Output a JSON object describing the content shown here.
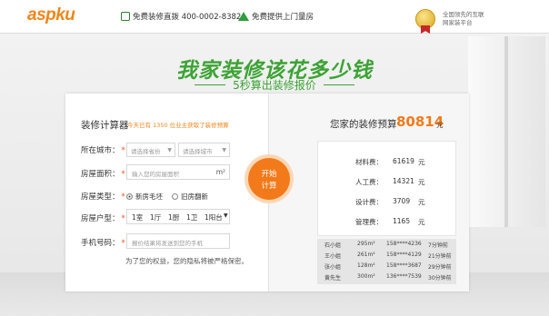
{
  "header": {
    "logo": "aspku",
    "hotline_text": "免费装修直拨 400-0002-8382",
    "house_text": "免费提供上门量房",
    "award_text": "全国领先的互联网家装平台"
  },
  "hero": {
    "title": "我家装修该花多少钱",
    "subtitle": "5秒算出装修报价"
  },
  "calculator": {
    "title": "装修计算器",
    "note": "今天已有 1350 位业主获取了装修预算",
    "city_label": "所在城市：",
    "province_placeholder": "请选择省份",
    "city_placeholder": "请选择城市",
    "area_label": "房屋面积：",
    "area_placeholder": "输入您的房屋面积",
    "area_unit": "m²",
    "type_label": "房屋类型：",
    "type_options": [
      "新房毛坯",
      "旧房翻新"
    ],
    "layout_label": "房屋户型：",
    "layout_options": [
      "1室",
      "1厅",
      "1厨",
      "1卫",
      "1阳台"
    ],
    "phone_label": "手机号码：",
    "phone_placeholder": "报价结果将发送到您的手机",
    "privacy_note": "为了您的权益，您的隐私将被严格保密。",
    "required_mark": "*",
    "start_button": [
      "开始",
      "计算"
    ]
  },
  "result": {
    "label": "您家的装修预算",
    "value": "80814",
    "unit": "元",
    "costs": [
      {
        "label": "材料费：",
        "value": "61619",
        "unit": "元"
      },
      {
        "label": "人工费：",
        "value": "14321",
        "unit": "元"
      },
      {
        "label": "设计费：",
        "value": "3709",
        "unit": "元"
      },
      {
        "label": "管理费：",
        "value": "1165",
        "unit": "元"
      }
    ],
    "records": [
      {
        "name": "石小姐",
        "area": "295m²",
        "phone": "158****4236",
        "time": "7分钟前"
      },
      {
        "name": "王小姐",
        "area": "261m²",
        "phone": "158****4129",
        "time": "21分钟前"
      },
      {
        "name": "张小姐",
        "area": "128m²",
        "phone": "158****3687",
        "time": "29分钟前"
      },
      {
        "name": "黄先生",
        "area": "300m²",
        "phone": "136****7539",
        "time": "30分钟前"
      }
    ]
  },
  "colors": {
    "brand_orange": "#f08519",
    "accent_green": "#3ca334"
  }
}
